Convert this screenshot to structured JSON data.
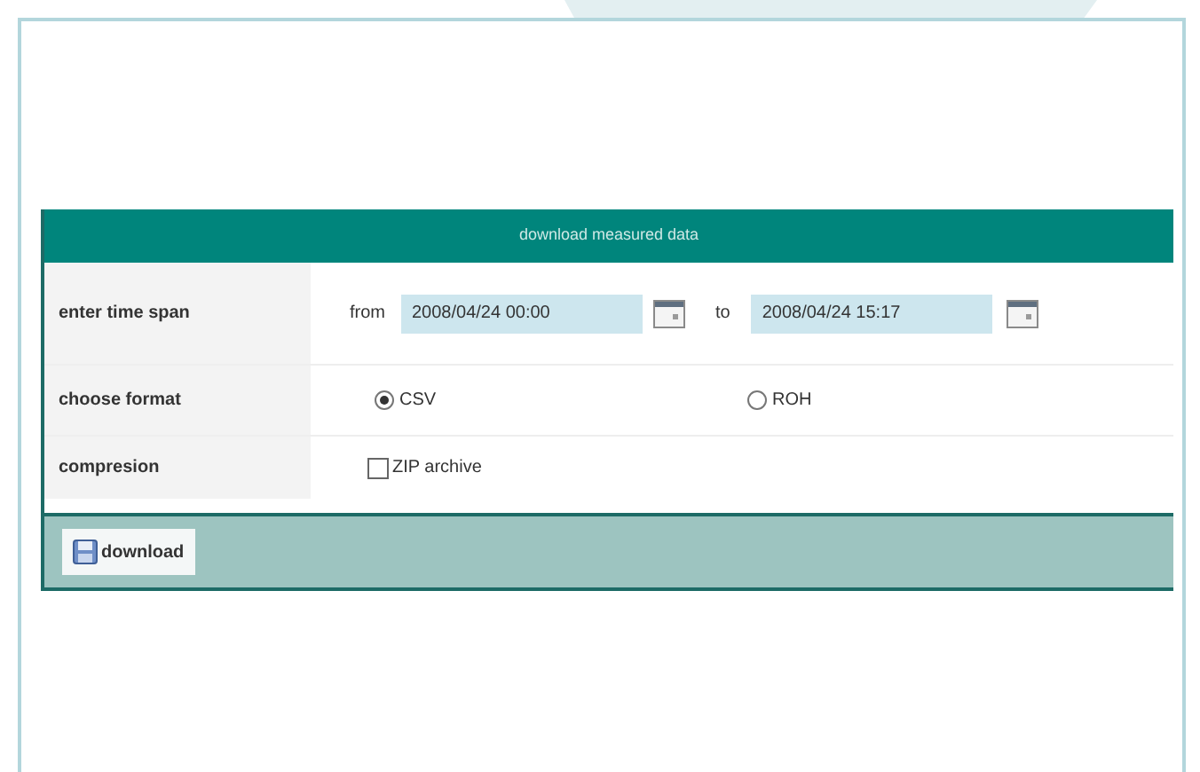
{
  "panel": {
    "title": "download measured data",
    "time_span": {
      "label": "enter time span",
      "from_label": "from",
      "from_value": "2008/04/24 00:00",
      "to_label": "to",
      "to_value": "2008/04/24 15:17"
    },
    "format": {
      "label": "choose format",
      "options": [
        {
          "label": "CSV",
          "selected": true
        },
        {
          "label": "ROH",
          "selected": false
        }
      ]
    },
    "compression": {
      "label": "compresion",
      "option": {
        "label": "ZIP archive",
        "checked": false
      }
    },
    "button": "download"
  }
}
